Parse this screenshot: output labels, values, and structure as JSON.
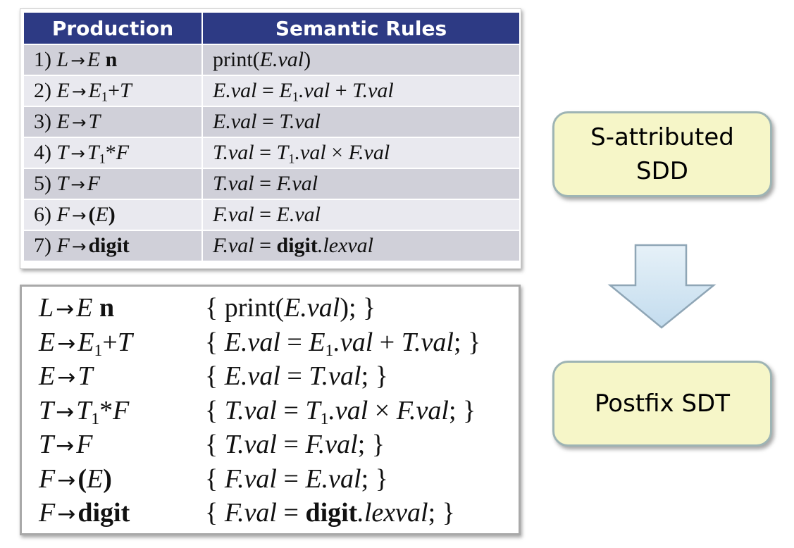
{
  "sdd_table": {
    "headers": [
      "Production",
      "Semantic Rules"
    ],
    "rows": [
      {
        "num": "1)",
        "lhs": "L",
        "rhs": [
          {
            "t": "E",
            "i": true
          },
          {
            "t": " "
          },
          {
            "t": "n",
            "b": true
          }
        ],
        "rule": [
          {
            "t": "print("
          },
          {
            "t": "E.val",
            "i": true
          },
          {
            "t": ")"
          }
        ]
      },
      {
        "num": "2)",
        "lhs": "E",
        "rhs": [
          {
            "t": "E",
            "i": true
          },
          {
            "t": "1",
            "sub": true
          },
          {
            "t": "+"
          },
          {
            "t": "T",
            "i": true
          }
        ],
        "rule": [
          {
            "t": "E.val",
            "i": true
          },
          {
            "t": " = "
          },
          {
            "t": "E",
            "i": true
          },
          {
            "t": "1",
            "sub": true
          },
          {
            "t": ".val",
            "i": true
          },
          {
            "t": " + "
          },
          {
            "t": "T.val",
            "i": true
          }
        ]
      },
      {
        "num": "3)",
        "lhs": "E",
        "rhs": [
          {
            "t": "T",
            "i": true
          }
        ],
        "rule": [
          {
            "t": "E.val",
            "i": true
          },
          {
            "t": " = "
          },
          {
            "t": "T.val",
            "i": true
          }
        ]
      },
      {
        "num": "4)",
        "lhs": "T",
        "rhs": [
          {
            "t": "T",
            "i": true
          },
          {
            "t": "1",
            "sub": true
          },
          {
            "t": "*"
          },
          {
            "t": "F",
            "i": true
          }
        ],
        "rule": [
          {
            "t": "T.val",
            "i": true
          },
          {
            "t": " = "
          },
          {
            "t": "T",
            "i": true
          },
          {
            "t": "1",
            "sub": true
          },
          {
            "t": ".val",
            "i": true
          },
          {
            "t": " × "
          },
          {
            "t": "F.val",
            "i": true
          }
        ]
      },
      {
        "num": "5)",
        "lhs": "T",
        "rhs": [
          {
            "t": "F",
            "i": true
          }
        ],
        "rule": [
          {
            "t": "T.val",
            "i": true
          },
          {
            "t": " = "
          },
          {
            "t": "F.val",
            "i": true
          }
        ]
      },
      {
        "num": "6)",
        "lhs": "F",
        "rhs": [
          {
            "t": "(",
            "b": true
          },
          {
            "t": "E",
            "i": true
          },
          {
            "t": ")",
            "b": true
          }
        ],
        "rule": [
          {
            "t": "F.val",
            "i": true
          },
          {
            "t": " = "
          },
          {
            "t": "E.val",
            "i": true
          }
        ]
      },
      {
        "num": "7)",
        "lhs": "F",
        "rhs": [
          {
            "t": "digit",
            "b": true
          }
        ],
        "rule": [
          {
            "t": "F.val",
            "i": true
          },
          {
            "t": " = "
          },
          {
            "t": "digit",
            "b": true
          },
          {
            "t": ".lexval",
            "i": true
          }
        ]
      }
    ]
  },
  "sdt_box": {
    "rows": [
      {
        "lhs": "L",
        "rhs": [
          {
            "t": "E",
            "i": true
          },
          {
            "t": " "
          },
          {
            "t": "n",
            "b": true
          }
        ],
        "action": [
          {
            "t": "{ print("
          },
          {
            "t": "E.val",
            "i": true
          },
          {
            "t": "); }"
          }
        ]
      },
      {
        "lhs": "E",
        "rhs": [
          {
            "t": "E",
            "i": true
          },
          {
            "t": "1",
            "sub": true
          },
          {
            "t": "+"
          },
          {
            "t": "T",
            "i": true
          }
        ],
        "action": [
          {
            "t": "{ "
          },
          {
            "t": "E.val",
            "i": true
          },
          {
            "t": " = "
          },
          {
            "t": "E",
            "i": true
          },
          {
            "t": "1",
            "sub": true
          },
          {
            "t": ".val",
            "i": true
          },
          {
            "t": " + "
          },
          {
            "t": "T.val",
            "i": true
          },
          {
            "t": "; }"
          }
        ]
      },
      {
        "lhs": "E",
        "rhs": [
          {
            "t": "T",
            "i": true
          }
        ],
        "action": [
          {
            "t": "{ "
          },
          {
            "t": "E.val",
            "i": true
          },
          {
            "t": " = "
          },
          {
            "t": "T.val",
            "i": true
          },
          {
            "t": "; }"
          }
        ]
      },
      {
        "lhs": "T",
        "rhs": [
          {
            "t": "T",
            "i": true
          },
          {
            "t": "1",
            "sub": true
          },
          {
            "t": "*"
          },
          {
            "t": "F",
            "i": true
          }
        ],
        "action": [
          {
            "t": "{ "
          },
          {
            "t": "T.val",
            "i": true
          },
          {
            "t": " = "
          },
          {
            "t": "T",
            "i": true
          },
          {
            "t": "1",
            "sub": true
          },
          {
            "t": ".val",
            "i": true
          },
          {
            "t": " × "
          },
          {
            "t": "F.val",
            "i": true
          },
          {
            "t": "; }"
          }
        ]
      },
      {
        "lhs": "T",
        "rhs": [
          {
            "t": "F",
            "i": true
          }
        ],
        "action": [
          {
            "t": "{ "
          },
          {
            "t": "T.val",
            "i": true
          },
          {
            "t": " = "
          },
          {
            "t": "F.val",
            "i": true
          },
          {
            "t": "; }"
          }
        ]
      },
      {
        "lhs": "F",
        "rhs": [
          {
            "t": "(",
            "b": true
          },
          {
            "t": "E",
            "i": true
          },
          {
            "t": ")",
            "b": true
          }
        ],
        "action": [
          {
            "t": "{ "
          },
          {
            "t": "F.val",
            "i": true
          },
          {
            "t": " = "
          },
          {
            "t": "E.val",
            "i": true
          },
          {
            "t": "; }"
          }
        ]
      },
      {
        "lhs": "F",
        "rhs": [
          {
            "t": "digit",
            "b": true
          }
        ],
        "action": [
          {
            "t": "{ "
          },
          {
            "t": "F.val",
            "i": true
          },
          {
            "t": " = "
          },
          {
            "t": "digit",
            "b": true
          },
          {
            "t": ".lexval",
            "i": true
          },
          {
            "t": "; }"
          }
        ]
      }
    ]
  },
  "arrow_symbol": "→",
  "s_attributed_box": {
    "line1": "S-attributed",
    "line2": "SDD"
  },
  "postfix_box": {
    "label": "Postfix SDT"
  },
  "colors": {
    "header_bg": "#2d3a84",
    "row_odd": "#d0d0d9",
    "row_even": "#e9e9ef",
    "box_fill": "#f6f6c8",
    "arrow_fill": "#d3e6f3"
  }
}
